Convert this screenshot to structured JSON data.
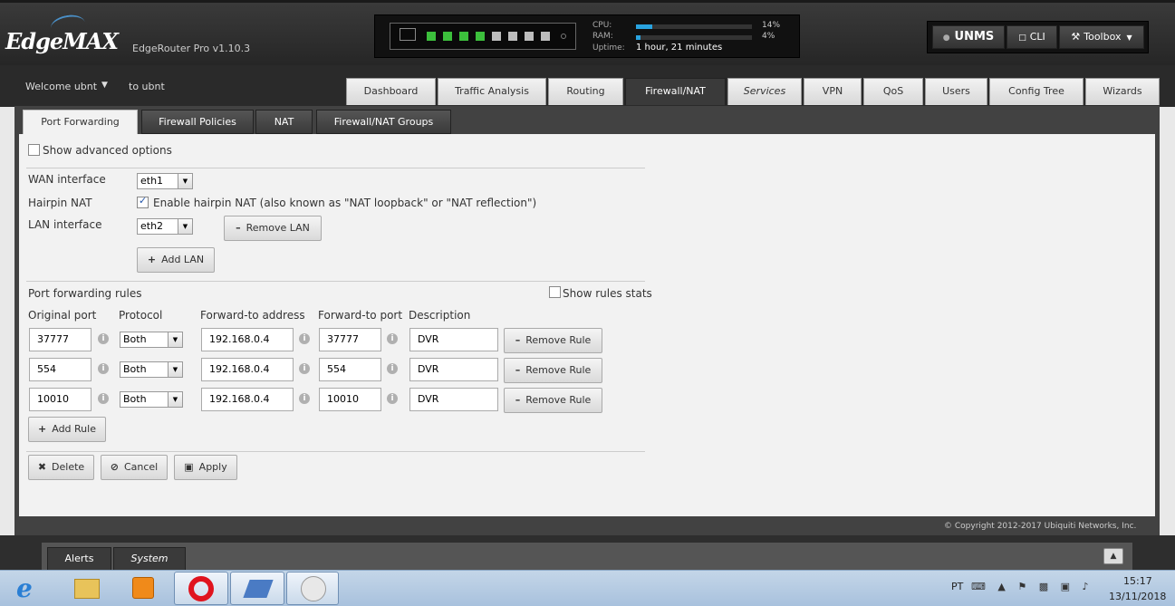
{
  "header": {
    "logo": "EdgeMAX",
    "model": "EdgeRouter Pro v1.10.3",
    "cpu_label": "CPU:",
    "cpu_value": "14%",
    "cpu_percent": 14,
    "ram_label": "RAM:",
    "ram_value": "4%",
    "ram_percent": 4,
    "uptime_label": "Uptime:",
    "uptime_value": "1 hour, 21 minutes",
    "unms_label": "UNMS",
    "cli_label": "CLI",
    "toolbox_label": "Toolbox",
    "port_colors": [
      "#3cbf3c",
      "#3cbf3c",
      "#3cbf3c",
      "#3cbf3c",
      "#bdbdbd",
      "#bdbdbd",
      "#bdbdbd",
      "#bdbdbd"
    ]
  },
  "welcome": {
    "text": "Welcome ubnt",
    "to_user": "to ubnt"
  },
  "main_tabs": [
    "Dashboard",
    "Traffic Analysis",
    "Routing",
    "Firewall/NAT",
    "Services",
    "VPN",
    "QoS",
    "Users",
    "Config Tree",
    "Wizards"
  ],
  "main_tab_active": "Firewall/NAT",
  "sub_tabs": [
    "Port Forwarding",
    "Firewall Policies",
    "NAT",
    "Firewall/NAT Groups"
  ],
  "sub_tab_active": "Port Forwarding",
  "form": {
    "show_advanced": "Show advanced options",
    "wan_label": "WAN interface",
    "wan_value": "eth1",
    "hairpin_label": "Hairpin NAT",
    "hairpin_text": "Enable hairpin NAT (also known as \"NAT loopback\" or \"NAT reflection\")",
    "hairpin_checked": true,
    "lan_label": "LAN interface",
    "lan_value": "eth2",
    "remove_lan": "Remove LAN",
    "add_lan": "Add LAN",
    "rules_title": "Port forwarding rules",
    "show_stats": "Show rules stats",
    "columns": [
      "Original port",
      "Protocol",
      "Forward-to address",
      "Forward-to port",
      "Description"
    ],
    "rules": [
      {
        "orig_port": "37777",
        "protocol": "Both",
        "fwd_addr": "192.168.0.4",
        "fwd_port": "37777",
        "desc": "DVR"
      },
      {
        "orig_port": "554",
        "protocol": "Both",
        "fwd_addr": "192.168.0.4",
        "fwd_port": "554",
        "desc": "DVR"
      },
      {
        "orig_port": "10010",
        "protocol": "Both",
        "fwd_addr": "192.168.0.4",
        "fwd_port": "10010",
        "desc": "DVR"
      }
    ],
    "remove_rule": "Remove Rule",
    "add_rule": "Add Rule",
    "delete": "Delete",
    "cancel": "Cancel",
    "apply": "Apply"
  },
  "copyright": "© Copyright 2012-2017 Ubiquiti Networks, Inc.",
  "bottom_tabs": [
    "Alerts",
    "System"
  ],
  "taskbar": {
    "lang": "PT",
    "time": "15:17",
    "date": "13/11/2018"
  }
}
